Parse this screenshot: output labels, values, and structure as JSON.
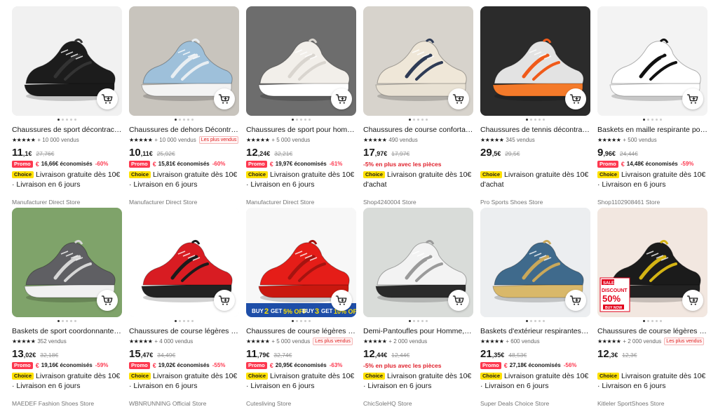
{
  "products": [
    {
      "title": "Chaussures de sport décontractées ...",
      "sold": "+ 10 000 vendus",
      "price_int": "11",
      "price_dec": ",1€",
      "orig": "27,76€",
      "badge": "",
      "promo": "Promo",
      "saved": "16,66€ économisés",
      "pct": "-60%",
      "red_note": "",
      "choice": "Choice",
      "ship": "Livraison gratuite dès 10€ · Livraison en 6 jours",
      "store": "Manufacturer Direct Store",
      "bg": "#f1f1f1",
      "shoe": "#1c1c1c",
      "accent": "#333333",
      "sole": "#1a1a1a"
    },
    {
      "title": "Chaussures de dehors Décontracté...",
      "sold": "+ 10 000 vendus",
      "price_int": "10",
      "price_dec": ",11€",
      "orig": "25,92€",
      "badge": "Les plus vendus",
      "promo": "Promo",
      "saved": "15,81€ économisés",
      "pct": "-60%",
      "red_note": "",
      "choice": "Choice",
      "ship": "Livraison gratuite dès 10€ · Livraison en 6 jours",
      "store": "Manufacturer Direct Store",
      "bg": "#c8c4bd",
      "shoe": "#9ec0da",
      "accent": "#e8eef2",
      "sole": "#f3f3f3"
    },
    {
      "title": "Chaussures de sport pour hommes ...",
      "sold": "+ 5 000 vendus",
      "price_int": "12",
      "price_dec": ",24€",
      "orig": "32,21€",
      "badge": "",
      "promo": "Promo",
      "saved": "19,97€ économisés",
      "pct": "-61%",
      "red_note": "",
      "choice": "Choice",
      "ship": "Livraison gratuite dès 10€ · Livraison en 6 jours",
      "store": "Manufacturer Direct Store",
      "bg": "#6d6d6d",
      "shoe": "#f2efea",
      "accent": "#d9d5cf",
      "sole": "#ffffff"
    },
    {
      "title": "Chaussures de course confortables ...",
      "sold": "490 vendus",
      "price_int": "17",
      "price_dec": ",97€",
      "orig": "17,97€",
      "badge": "",
      "promo": "",
      "saved": "",
      "pct": "",
      "red_note": "-5% en plus avec les pièces",
      "choice": "Choice",
      "ship": "Livraison gratuite dès 10€ d'achat",
      "store": "Shop4240004 Store",
      "bg": "#d7d3cc",
      "shoe": "#efe7d8",
      "accent": "#2e3b55",
      "sole": "#e9e2d4"
    },
    {
      "title": "Chaussures de tennis décontractée...",
      "sold": "345 vendus",
      "price_int": "29",
      "price_dec": ",5€",
      "orig": "29,5€",
      "badge": "",
      "promo": "",
      "saved": "",
      "pct": "",
      "red_note": "",
      "choice": "Choice",
      "ship": "Livraison gratuite dès 10€ d'achat",
      "store": "Pro Sports Shoes Store",
      "bg": "#2b2b2b",
      "shoe": "#e3e3e3",
      "accent": "#f05a1a",
      "sole": "#f47a2a"
    },
    {
      "title": "Baskets en maille respirante pour h...",
      "sold": "+ 500 vendus",
      "price_int": "9",
      "price_dec": ",96€",
      "orig": "24,44€",
      "badge": "",
      "promo": "Promo",
      "saved": "14,48€ économisés",
      "pct": "-59%",
      "red_note": "",
      "choice": "Choice",
      "ship": "Livraison gratuite dès 10€ · Livraison en 6 jours",
      "store": "Shop1102908461 Store",
      "bg": "#f3f3f3",
      "shoe": "#ffffff",
      "accent": "#111111",
      "sole": "#ffffff"
    },
    {
      "title": "Baskets de sport coordonnantes po...",
      "sold": "352 vendus",
      "price_int": "13",
      "price_dec": ",02€",
      "orig": "32,18€",
      "badge": "",
      "promo": "Promo",
      "saved": "19,16€ économisés",
      "pct": "-59%",
      "red_note": "",
      "choice": "Choice",
      "ship": "Livraison gratuite dès 10€ · Livraison en 6 jours",
      "store": "MAEDEF Fashion Shoes Store",
      "bg": "#7fa36a",
      "shoe": "#5f5f63",
      "accent": "#d6d6d6",
      "sole": "#f1f1f1"
    },
    {
      "title": "Chaussures de course légères et res...",
      "sold": "+ 4 000 vendus",
      "price_int": "15",
      "price_dec": ",47€",
      "orig": "34,49€",
      "badge": "",
      "promo": "Promo",
      "saved": "19,02€ économisés",
      "pct": "-55%",
      "red_note": "",
      "choice": "Choice",
      "ship": "Livraison gratuite dès 10€ · Livraison en 6 jours",
      "store": "WBNRUNNING Official Store",
      "bg": "#ffffff",
      "shoe": "#d81c22",
      "accent": "#1b1b1b",
      "sole": "#222222"
    },
    {
      "title": "Chaussures de course légères à imp...",
      "sold": "+ 5 000 vendus",
      "price_int": "11",
      "price_dec": ",79€",
      "orig": "32,74€",
      "badge": "Les plus vendus",
      "promo": "Promo",
      "saved": "20,95€ économisés",
      "pct": "-63%",
      "red_note": "",
      "choice": "Choice",
      "ship": "Livraison gratuite dès 10€ · Livraison en 6 jours",
      "store": "Cutesliving Store",
      "bg": "#f7f7f7",
      "shoe": "#e51d18",
      "accent": "#a51410",
      "sole": "#c9180f",
      "banner_a": "BUY",
      "banner_b": "2",
      "banner_c": "GET",
      "banner_d": "5% OFF",
      "banner_e": "BUY",
      "banner_f": "3",
      "banner_g": "GET",
      "banner_h": "10% OFF"
    },
    {
      "title": "Demi-Pantoufles pour Homme, Cha...",
      "sold": "+ 2 000 vendus",
      "price_int": "12",
      "price_dec": ",44€",
      "orig": "12,44€",
      "badge": "",
      "promo": "",
      "saved": "",
      "pct": "",
      "red_note": "-5% en plus avec les pièces",
      "choice": "Choice",
      "ship": "Livraison gratuite dès 10€ · Livraison en 6 jours",
      "store": "ChicSoleHQ Store",
      "bg": "#d9dcd9",
      "shoe": "#f3f3f3",
      "accent": "#9a9a9a",
      "sole": "#2a2a2a"
    },
    {
      "title": "Baskets d'extérieur respirantes en ...",
      "sold": "+ 600 vendus",
      "price_int": "21",
      "price_dec": ",35€",
      "orig": "48,53€",
      "badge": "",
      "promo": "Promo",
      "saved": "27,18€ économisés",
      "pct": "-56%",
      "red_note": "",
      "choice": "Choice",
      "ship": "Livraison gratuite dès 10€ · Livraison en 6 jours",
      "store": "Super Deals Choice Store",
      "bg": "#eceef0",
      "shoe": "#3f6a8c",
      "accent": "#c9a85a",
      "sole": "#d9b86a"
    },
    {
      "title": "Chaussures de course légères respi...",
      "sold": "+ 2 000 vendus",
      "price_int": "12",
      "price_dec": ",3€",
      "orig": "12,3€",
      "badge": "Les plus vendus",
      "promo": "",
      "saved": "",
      "pct": "",
      "red_note": "",
      "choice": "Choice",
      "ship": "Livraison gratuite dès 10€ · Livraison en 6 jours",
      "store": "Kitleler SportShoes Store",
      "bg": "#f2e7e0",
      "shoe": "#1b1b1b",
      "accent": "#d4b414",
      "sole": "#222222",
      "sale": "SALE",
      "discount": "DISCOUNT",
      "discount_pct": "50%",
      "buy_now": "BUY NOW"
    }
  ]
}
